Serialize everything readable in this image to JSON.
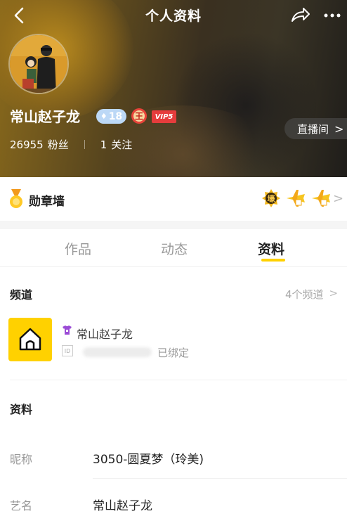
{
  "header": {
    "title": "个人资料",
    "back_icon": "chevron-left-icon",
    "share_icon": "share-icon",
    "more_icon": "more-dots-icon"
  },
  "profile": {
    "username": "常山赵子龙",
    "level": "18",
    "vip": "VIP5",
    "noble_badge_char": "王",
    "fans_count": "26955",
    "fans_label": "粉丝",
    "following_count": "1",
    "following_label": "关注",
    "live_room_label": "直播间"
  },
  "medal_wall": {
    "title": "勋章墙",
    "badge_char": "壕"
  },
  "tabs": [
    {
      "label": "作品",
      "active": false
    },
    {
      "label": "动态",
      "active": false
    },
    {
      "label": "资料",
      "active": true
    }
  ],
  "channel": {
    "section_title": "频道",
    "count_label": "4个频道",
    "name": "常山赵子龙",
    "id_label": "ID",
    "bound_label": "已绑定"
  },
  "info": {
    "section_title": "资料",
    "rows": [
      {
        "label": "昵称",
        "value": "3050-圆夏梦（玲美)"
      },
      {
        "label": "艺名",
        "value": "常山赵子龙"
      }
    ]
  },
  "colors": {
    "accent": "#ffd100",
    "vip_red": "#e63c3c",
    "level_blue": "#bcd8f6"
  }
}
